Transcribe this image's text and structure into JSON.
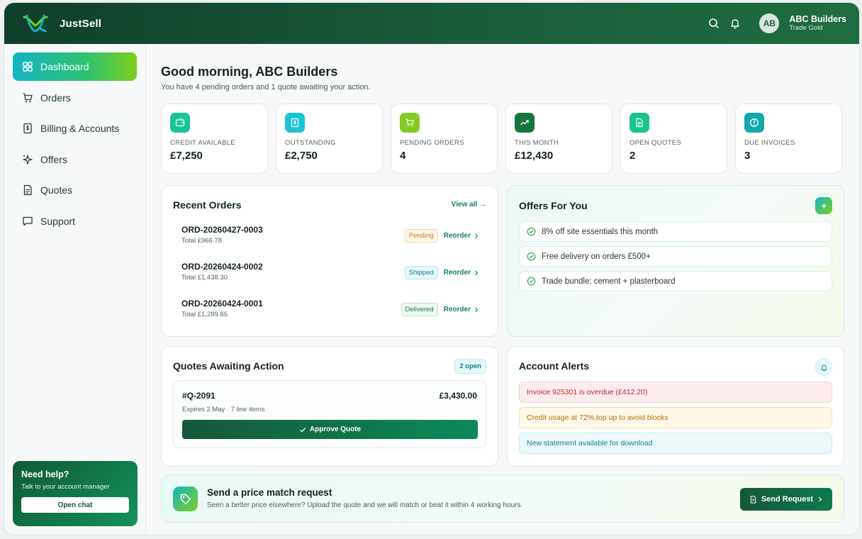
{
  "app": {
    "name": "JustSell"
  },
  "header": {
    "icons": [
      "search-icon",
      "bell-icon"
    ],
    "user": {
      "initials": "AB",
      "name": "ABC Builders",
      "tier": "Trade Gold"
    }
  },
  "sidebar": {
    "items": [
      {
        "label": "Dashboard",
        "icon": "dashboard-grid-icon",
        "active": true
      },
      {
        "label": "Orders",
        "icon": "cart-icon"
      },
      {
        "label": "Billing & Accounts",
        "icon": "billing-icon"
      },
      {
        "label": "Offers",
        "icon": "sparkles-icon"
      },
      {
        "label": "Quotes",
        "icon": "document-icon"
      },
      {
        "label": "Support",
        "icon": "chat-icon"
      }
    ],
    "help": {
      "title": "Need help?",
      "subtitle": "Talk to your account manager",
      "button": "Open chat"
    }
  },
  "greeting": {
    "title": "Good morning, ABC Builders",
    "subtitle": "You have 4 pending orders and 1 quote awaiting your action."
  },
  "stats": [
    {
      "label": "CREDIT AVAILABLE",
      "value": "£7,250",
      "icon": "wallet-icon",
      "color": "#18c49a"
    },
    {
      "label": "OUTSTANDING",
      "value": "£2,750",
      "icon": "dollar-doc-icon",
      "color": "#1cc3d6"
    },
    {
      "label": "PENDING ORDERS",
      "value": "4",
      "icon": "cart-icon",
      "color": "#82cc22"
    },
    {
      "label": "THIS MONTH",
      "value": "£12,430",
      "icon": "trend-up-icon",
      "color": "#17753f"
    },
    {
      "label": "OPEN QUOTES",
      "value": "2",
      "icon": "document-icon",
      "color": "#1ac28e"
    },
    {
      "label": "DUE INVOICES",
      "value": "3",
      "icon": "alert-circle-icon",
      "color": "#14a6ad"
    }
  ],
  "recent_orders": {
    "title": "Recent Orders",
    "view_all": "View all →",
    "reorder_label": "Reorder",
    "rows": [
      {
        "id": "ORD-20260427-0003",
        "total": "Total £966.78",
        "status": "Pending"
      },
      {
        "id": "ORD-20260424-0002",
        "total": "Total £1,438.30",
        "status": "Shipped"
      },
      {
        "id": "ORD-20260424-0001",
        "total": "Total £1,289.65",
        "status": "Delivered"
      }
    ]
  },
  "offers": {
    "title": "Offers For You",
    "items": [
      "8% off site essentials this month",
      "Free delivery on orders £500+",
      "Trade bundle: cement + plasterboard"
    ]
  },
  "quotes": {
    "title": "Quotes Awaiting Action",
    "badge": "2 open",
    "quote": {
      "id": "#Q-2091",
      "amount": "£3,430.00",
      "meta": "Expires 2 May · 7 line items",
      "button": "Approve Quote"
    }
  },
  "alerts": {
    "title": "Account Alerts",
    "items": [
      {
        "text": "Invoice 925301 is overdue (£412.20)",
        "tone": "red"
      },
      {
        "text": "Credit usage at 72%,top up to avoid blocks",
        "tone": "amber"
      },
      {
        "text": "New statement available for download",
        "tone": "cyan"
      }
    ]
  },
  "price_match": {
    "title": "Send a price match request",
    "subtitle": "Seen a better price elsewhere? Upload the quote and we will match or beat it within 4 working hours.",
    "button": "Send Request"
  }
}
